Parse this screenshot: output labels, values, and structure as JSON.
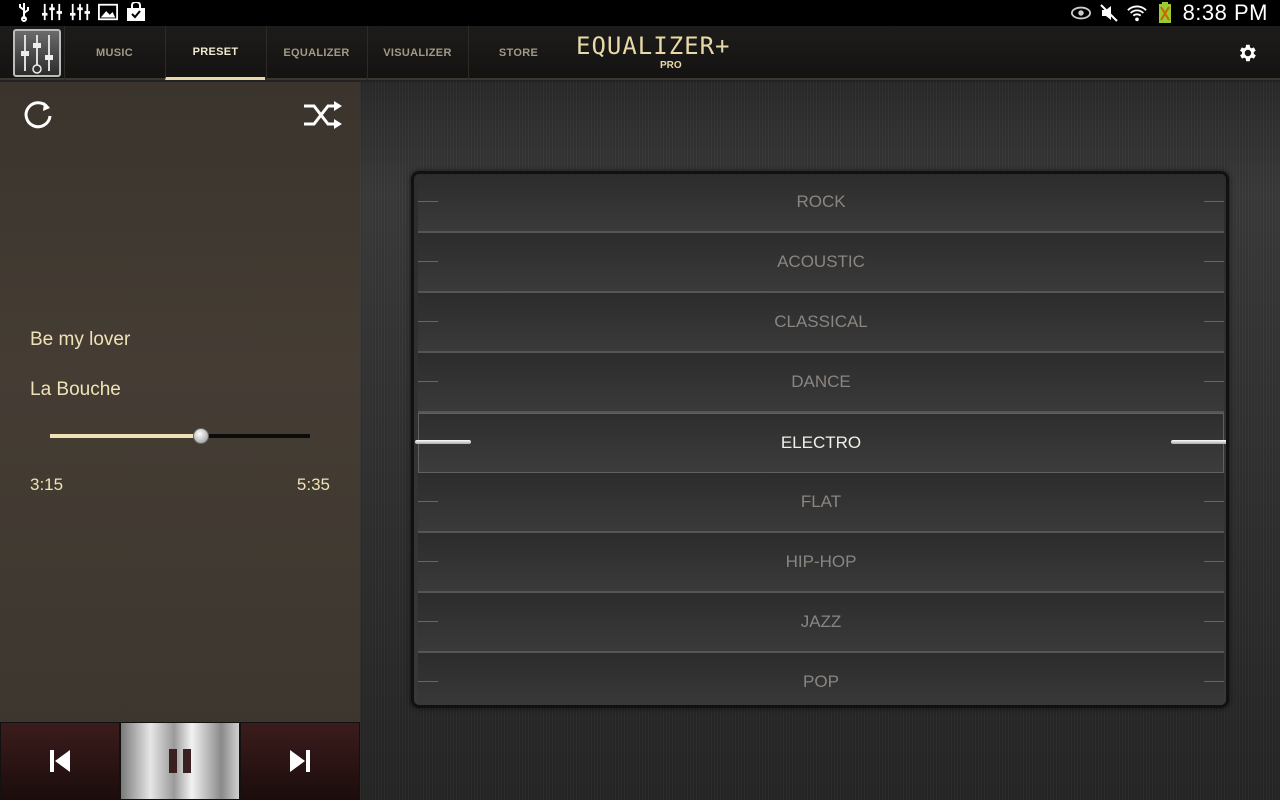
{
  "status_bar": {
    "time": "8:38 PM",
    "left_icons": [
      "usb-icon",
      "equalizer-notification-icon",
      "equalizer-notification-icon",
      "gallery-icon",
      "shopping-bag-icon"
    ],
    "right_icons": [
      "eye-icon",
      "mute-icon",
      "wifi-icon",
      "battery-icon"
    ]
  },
  "nav": {
    "tabs": [
      {
        "label": "MUSIC",
        "active": false
      },
      {
        "label": "PRESET",
        "active": true
      },
      {
        "label": "EQUALIZER",
        "active": false
      },
      {
        "label": "VISUALIZER",
        "active": false
      },
      {
        "label": "STORE",
        "active": false
      }
    ],
    "brand": "EQUALIZER+",
    "brand_sub": "PRO",
    "settings_icon": "gear-icon"
  },
  "player": {
    "song_title": "Be my lover",
    "artist": "La Bouche",
    "current_time": "3:15",
    "total_time": "5:35",
    "progress": 0.58
  },
  "presets": {
    "items": [
      "ROCK",
      "ACOUSTIC",
      "CLASSICAL",
      "DANCE",
      "ELECTRO",
      "FLAT",
      "HIP-HOP",
      "JAZZ",
      "POP"
    ],
    "selected": "ELECTRO"
  },
  "colors": {
    "accent": "#f0e2b6",
    "tab_inactive": "#a39a86",
    "preset_inactive": "#8a8580"
  }
}
